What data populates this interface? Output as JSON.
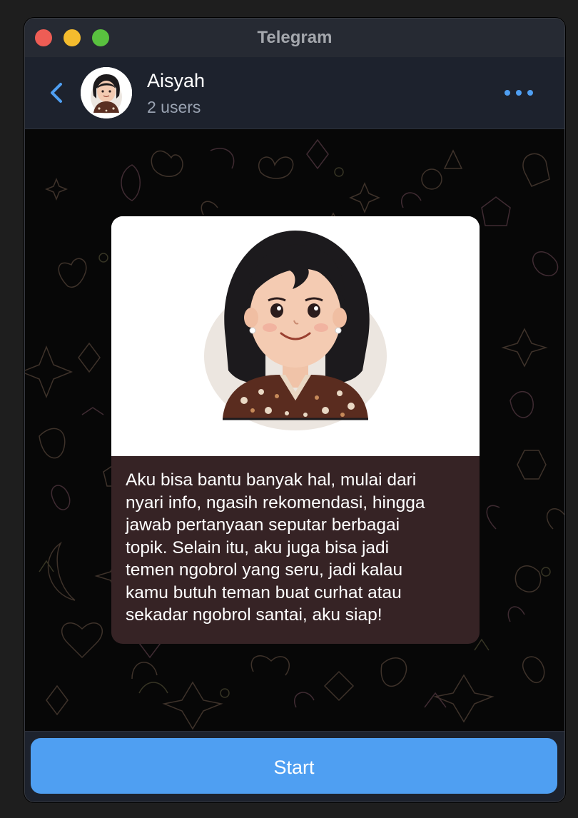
{
  "window": {
    "title": "Telegram"
  },
  "header": {
    "chat_name": "Aisyah",
    "subtitle": "2 users",
    "back_icon": "chevron-left-icon",
    "more_icon": "more-horizontal-icon",
    "avatar_caption": "Aisyah"
  },
  "message": {
    "text": "Aku bisa bantu banyak hal, mulai dari\nnyari info, ngasih rekomendasi, hingga\njawab pertanyaan seputar berbagai\ntopik. Selain itu, aku juga bisa jadi\ntemen ngobrol yang seru, jadi kalau\nkamu butuh teman buat curhat atau\nsekadar ngobrol santai, aku siap!"
  },
  "footer": {
    "start_label": "Start"
  },
  "colors": {
    "accent": "#4f9ff2",
    "header_bg": "#1d222d",
    "bubble_bg": "#362325",
    "chat_bg": "#070707"
  }
}
